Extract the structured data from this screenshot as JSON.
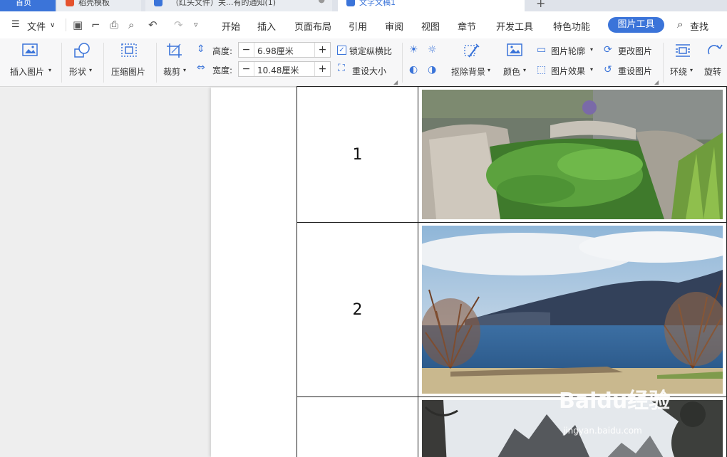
{
  "tabs": [
    {
      "label": "首页"
    },
    {
      "label": "稻壳模板"
    },
    {
      "label": "（红头文件）关...有的通知(1)"
    },
    {
      "label": "文字文稿1"
    }
  ],
  "menu": {
    "file": "文件",
    "items": [
      "开始",
      "插入",
      "页面布局",
      "引用",
      "审阅",
      "视图",
      "章节",
      "开发工具",
      "特色功能"
    ],
    "active": "图片工具",
    "search": "查找"
  },
  "ribbon": {
    "insert_picture": "插入图片",
    "shape": "形状",
    "compress": "压缩图片",
    "crop": "裁剪",
    "height_label": "高度:",
    "height_value": "6.98厘米",
    "width_label": "宽度:",
    "width_value": "10.48厘米",
    "lock_ratio": "锁定纵横比",
    "reset_size": "重设大小",
    "remove_bg": "抠除背景",
    "color": "颜色",
    "outline": "图片轮廓",
    "effect": "图片效果",
    "change_picture": "更改图片",
    "reset_picture": "重设图片",
    "wrap": "环绕",
    "rotate": "旋转"
  },
  "table": {
    "rows": [
      {
        "number": "1"
      },
      {
        "number": "2"
      },
      {
        "number": ""
      }
    ]
  },
  "watermark": {
    "brand": "Baidu经验",
    "url": "jingyan.baidu.com"
  },
  "colors": {
    "accent": "#3b74d9"
  }
}
